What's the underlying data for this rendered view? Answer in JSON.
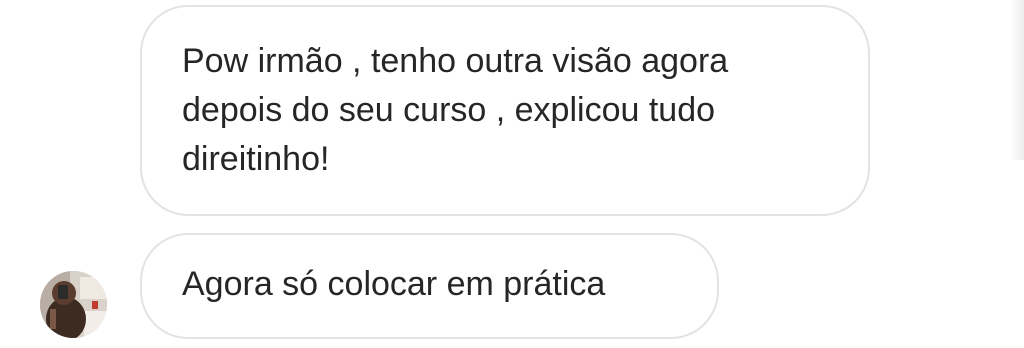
{
  "messages": [
    {
      "text": "Pow irmão , tenho outra visão agora\ndepois do seu curso , explicou tudo\ndireitinho!"
    },
    {
      "text": "Agora só colocar em prática"
    }
  ],
  "sender": {
    "avatar_icon": "profile-photo-avatar"
  },
  "colors": {
    "background": "#ffffff",
    "bubble_border": "#e3e3e3",
    "text": "#262626"
  }
}
